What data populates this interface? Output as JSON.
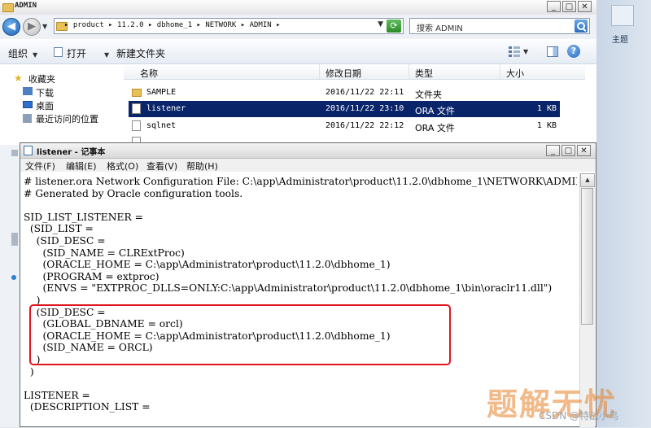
{
  "explorer": {
    "title": "ADMIN",
    "address_path": "▸ product ▸ 11.2.0 ▸ dbhome_1 ▸ NETWORK ▸ ADMIN ▸",
    "search_placeholder": "搜索 ADMIN",
    "toolbar": {
      "organize": "组织",
      "open": "打开",
      "new_folder": "新建文件夹"
    },
    "nav": {
      "favorites": "收藏夹",
      "downloads": "下载",
      "desktop": "桌面",
      "recent": "最近访问的位置"
    },
    "columns": {
      "name": "名称",
      "date": "修改日期",
      "type": "类型",
      "size": "大小"
    },
    "files": [
      {
        "name": "SAMPLE",
        "date": "2016/11/22 22:11",
        "type": "文件夹",
        "size": ""
      },
      {
        "name": "listener",
        "date": "2016/11/22 23:10",
        "type": "ORA 文件",
        "size": "1 KB"
      },
      {
        "name": "sqlnet",
        "date": "2016/11/22 22:12",
        "type": "ORA 文件",
        "size": "1 KB"
      }
    ]
  },
  "side_panel": {
    "theme_label": "主题"
  },
  "notepad": {
    "title": "listener - 记事本",
    "menu": [
      "文件(F)",
      "编辑(E)",
      "格式(O)",
      "查看(V)",
      "帮助(H)"
    ],
    "text": "# listener.ora Network Configuration File: C:\\app\\Administrator\\product\\11.2.0\\dbhome_1\\NETWORK\\ADMIN\\listener.ora\n# Generated by Oracle configuration tools.\n\nSID_LIST_LISTENER =\n  (SID_LIST =\n    (SID_DESC =\n      (SID_NAME = CLRExtProc)\n      (ORACLE_HOME = C:\\app\\Administrator\\product\\11.2.0\\dbhome_1)\n      (PROGRAM = extproc)\n      (ENVS = \"EXTPROC_DLLS=ONLY:C:\\app\\Administrator\\product\\11.2.0\\dbhome_1\\bin\\oraclr11.dll\")\n    )\n    (SID_DESC =\n      (GLOBAL_DBNAME = orcl)\n      (ORACLE_HOME = C:\\app\\Administrator\\product\\11.2.0\\dbhome_1)\n      (SID_NAME = ORCL)\n    )\n  )\n\nLISTENER =\n  (DESCRIPTION_LIST ="
  },
  "watermark": {
    "text": "题解无忧",
    "credit": "CSDN @特战小鸟"
  },
  "colors": {
    "selection": "#0a246a",
    "highlight_box": "#e0141e",
    "watermark": "#e88228"
  }
}
